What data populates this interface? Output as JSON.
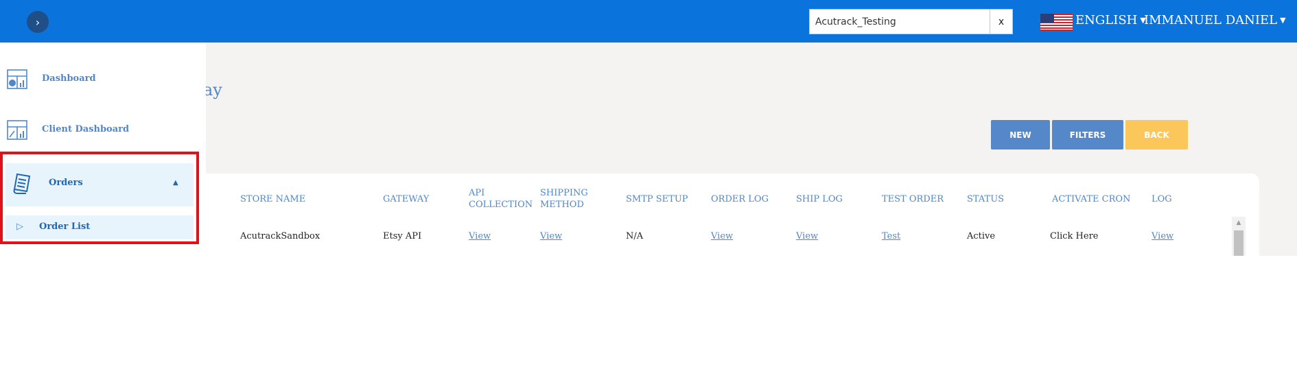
{
  "header": {
    "search_value": "Acutrack_Testing",
    "search_clear": "x",
    "language": "ENGLISH",
    "user_name": "IMMANUEL DANIEL"
  },
  "sidebar": {
    "items": [
      {
        "label": "Dashboard",
        "icon": "dashboard-icon"
      },
      {
        "label": "Client Dashboard",
        "icon": "client-dashboard-icon"
      },
      {
        "label": "Orders",
        "icon": "orders-icon"
      }
    ],
    "sub_items": [
      {
        "label": "Order List",
        "icon": "play-outline-icon"
      }
    ]
  },
  "page": {
    "title_fragment": "ay"
  },
  "actions": {
    "new_label": "NEW",
    "filters_label": "FILTERS",
    "back_label": "BACK"
  },
  "table": {
    "headers": [
      "STORE NAME",
      "GATEWAY",
      "API COLLECTION",
      "SHIPPING METHOD",
      "SMTP SETUP",
      "ORDER LOG",
      "SHIP LOG",
      "TEST ORDER",
      "STATUS",
      "ACTIVATE CRON",
      "LOG"
    ],
    "rows": [
      [
        "AcutrackSandbox",
        "Etsy API",
        "View",
        "View",
        "N/A",
        "View",
        "View",
        "Test",
        "Active",
        "Click Here",
        "View"
      ]
    ]
  },
  "colors": {
    "topbar": "#0a74dc",
    "accent": "#4f87c9",
    "back_button": "#fcc75a",
    "highlight_border": "#e3101a"
  }
}
